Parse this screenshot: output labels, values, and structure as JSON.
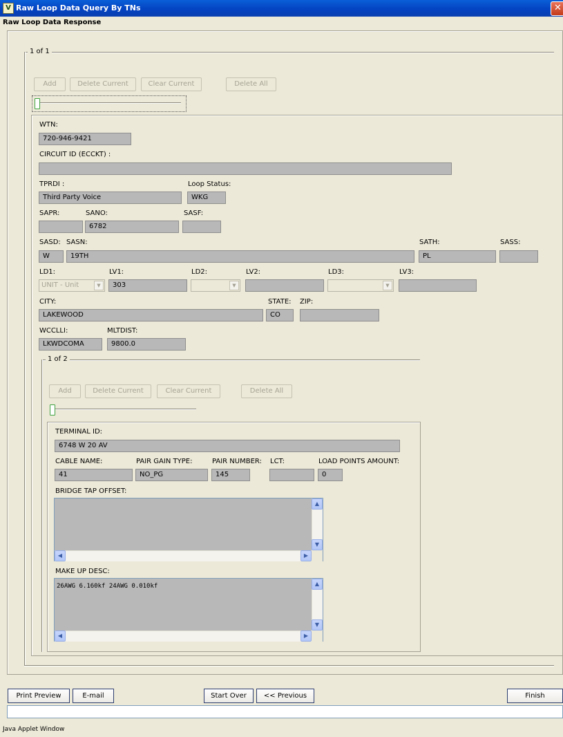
{
  "window": {
    "title": "Raw Loop Data Query By TNs",
    "app_icon": "V"
  },
  "header": {
    "subtitle": "Raw Loop Data Response"
  },
  "record_group": {
    "label": "1 of 1",
    "buttons": {
      "add": "Add",
      "delete_current": "Delete Current",
      "clear_current": "Clear Current",
      "delete_all": "Delete All"
    },
    "slider_position": 0
  },
  "record": {
    "wtn": {
      "label": "WTN:",
      "value": "720-946-9421"
    },
    "circuit_id": {
      "label": "CIRCUIT ID (ECCKT) :",
      "value": ""
    },
    "tprdi": {
      "label": "TPRDI :",
      "value": "Third Party Voice"
    },
    "loop_status": {
      "label": "Loop Status:",
      "value": "WKG"
    },
    "sapr": {
      "label": "SAPR:",
      "value": ""
    },
    "sano": {
      "label": "SANO:",
      "value": "6782"
    },
    "sasf": {
      "label": "SASF:",
      "value": ""
    },
    "sasd": {
      "label": "SASD:",
      "value": "W"
    },
    "sasn": {
      "label": "SASN:",
      "value": "19TH"
    },
    "sath": {
      "label": "SATH:",
      "value": "PL"
    },
    "sass": {
      "label": "SASS:",
      "value": ""
    },
    "ld1": {
      "label": "LD1:",
      "value": "UNIT - Unit"
    },
    "lv1": {
      "label": "LV1:",
      "value": "303"
    },
    "ld2": {
      "label": "LD2:",
      "value": ""
    },
    "lv2": {
      "label": "LV2:",
      "value": ""
    },
    "ld3": {
      "label": "LD3:",
      "value": ""
    },
    "lv3": {
      "label": "LV3:",
      "value": ""
    },
    "city": {
      "label": "CITY:",
      "value": "LAKEWOOD"
    },
    "state": {
      "label": "STATE:",
      "value": "CO"
    },
    "zip": {
      "label": "ZIP:",
      "value": ""
    },
    "wcclli": {
      "label": "WCCLLI:",
      "value": "LKWDCOMA"
    },
    "mltdist": {
      "label": "MLTDIST:",
      "value": "9800.0"
    }
  },
  "terminal_group": {
    "label": "1 of 2",
    "buttons": {
      "add": "Add",
      "delete_current": "Delete Current",
      "clear_current": "Clear Current",
      "delete_all": "Delete All"
    },
    "slider_position": 0
  },
  "terminal": {
    "terminal_id": {
      "label": "TERMINAL ID:",
      "value": "6748 W 20 AV"
    },
    "cable_name": {
      "label": "CABLE NAME:",
      "value": "41"
    },
    "pair_gain_type": {
      "label": "PAIR GAIN TYPE:",
      "value": "NO_PG"
    },
    "pair_number": {
      "label": "PAIR NUMBER:",
      "value": "145"
    },
    "lct": {
      "label": "LCT:",
      "value": ""
    },
    "load_points": {
      "label": "LOAD POINTS AMOUNT:",
      "value": "0"
    },
    "bridge_tap": {
      "label": "BRIDGE TAP OFFSET:",
      "value": ""
    },
    "make_up_desc": {
      "label": "MAKE UP DESC:",
      "value": "26AWG 6.160kf 24AWG 0.010kf"
    }
  },
  "footer": {
    "print_preview": "Print Preview",
    "email": "E-mail",
    "start_over": "Start Over",
    "previous": "<< Previous",
    "finish": "Finish",
    "status_text": "",
    "applet_note": "Java Applet Window"
  },
  "colors": {
    "titlebar": "#0443c2",
    "field_bg": "#b8b8b8",
    "window_bg": "#ece9d8"
  }
}
